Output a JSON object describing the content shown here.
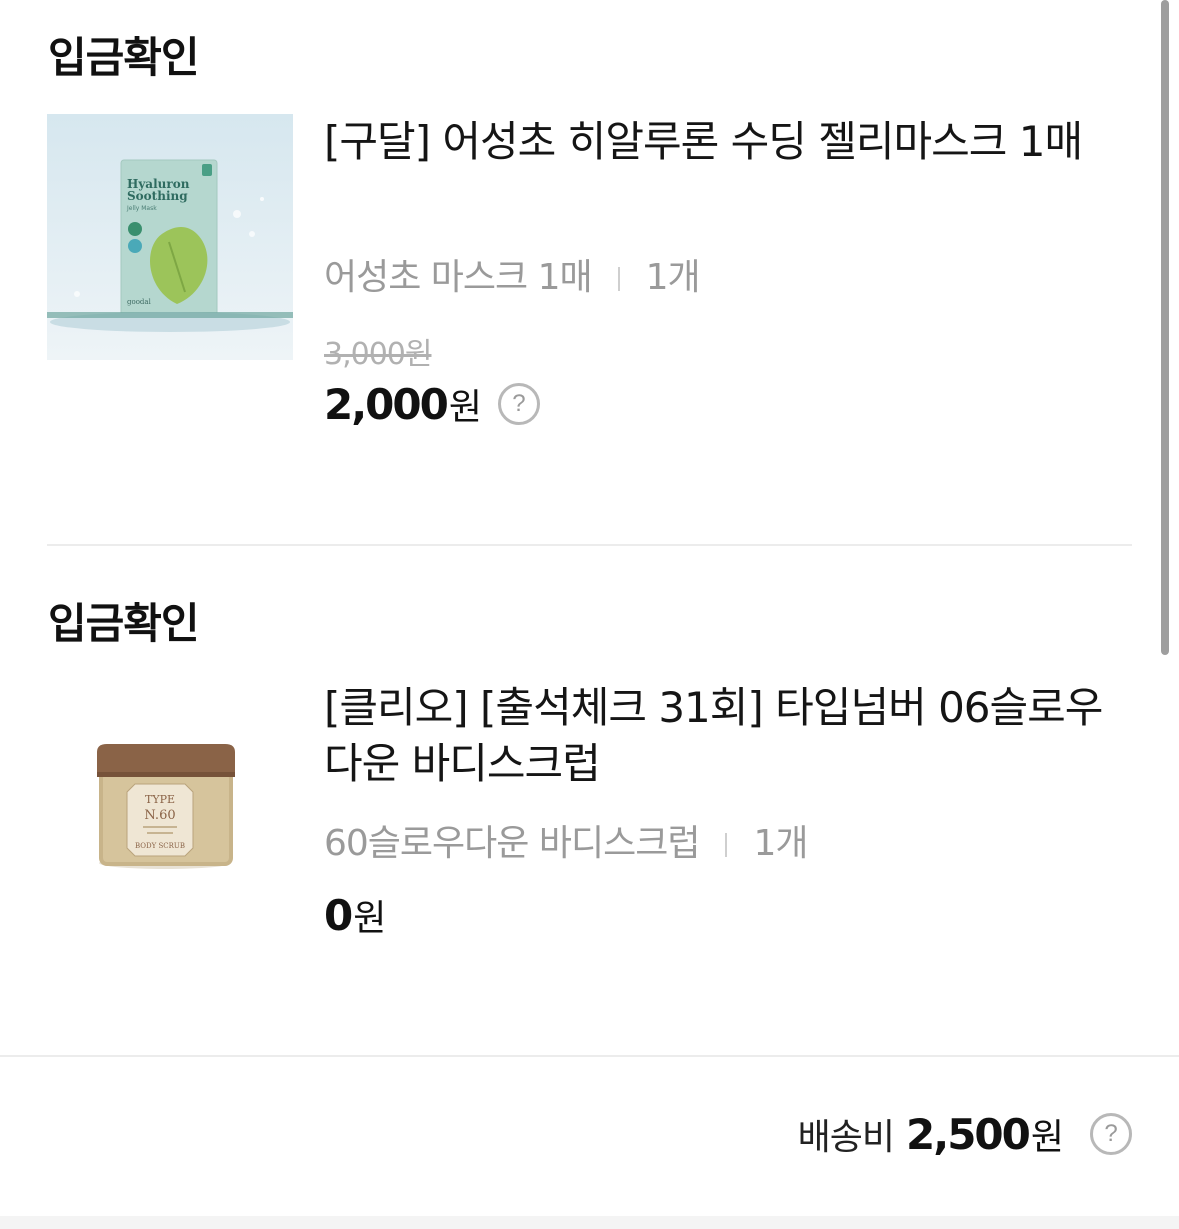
{
  "orders": [
    {
      "status": "입금확인",
      "title": "[구달] 어성초 히알루론 수딩 젤리마스크 1매",
      "option": "어성초 마스크 1매",
      "quantity": "1개",
      "original_price": "3,000원",
      "price_number": "2,000",
      "price_unit": "원",
      "help_icon": "?",
      "image_text": {
        "line1": "Hyaluron",
        "line2": "Soothing",
        "line3": "Jelly Mask",
        "brand": "goodal"
      }
    },
    {
      "status": "입금확인",
      "title": "[클리오] [출석체크 31회] 타입넘버 06슬로우다운 바디스크럽",
      "option": "60슬로우다운 바디스크럽",
      "quantity": "1개",
      "price_number": "0",
      "price_unit": "원",
      "image_text": {
        "line1": "TYPE",
        "line2": "N.60",
        "line3": "BODY SCRUB"
      }
    }
  ],
  "shipping": {
    "label": "배송비",
    "amount_number": "2,500",
    "amount_unit": "원",
    "help_icon": "?"
  },
  "colors": {
    "text": "#111111",
    "muted": "#9a9a9a",
    "strike": "#b1b1b1",
    "divider": "#ececec"
  }
}
